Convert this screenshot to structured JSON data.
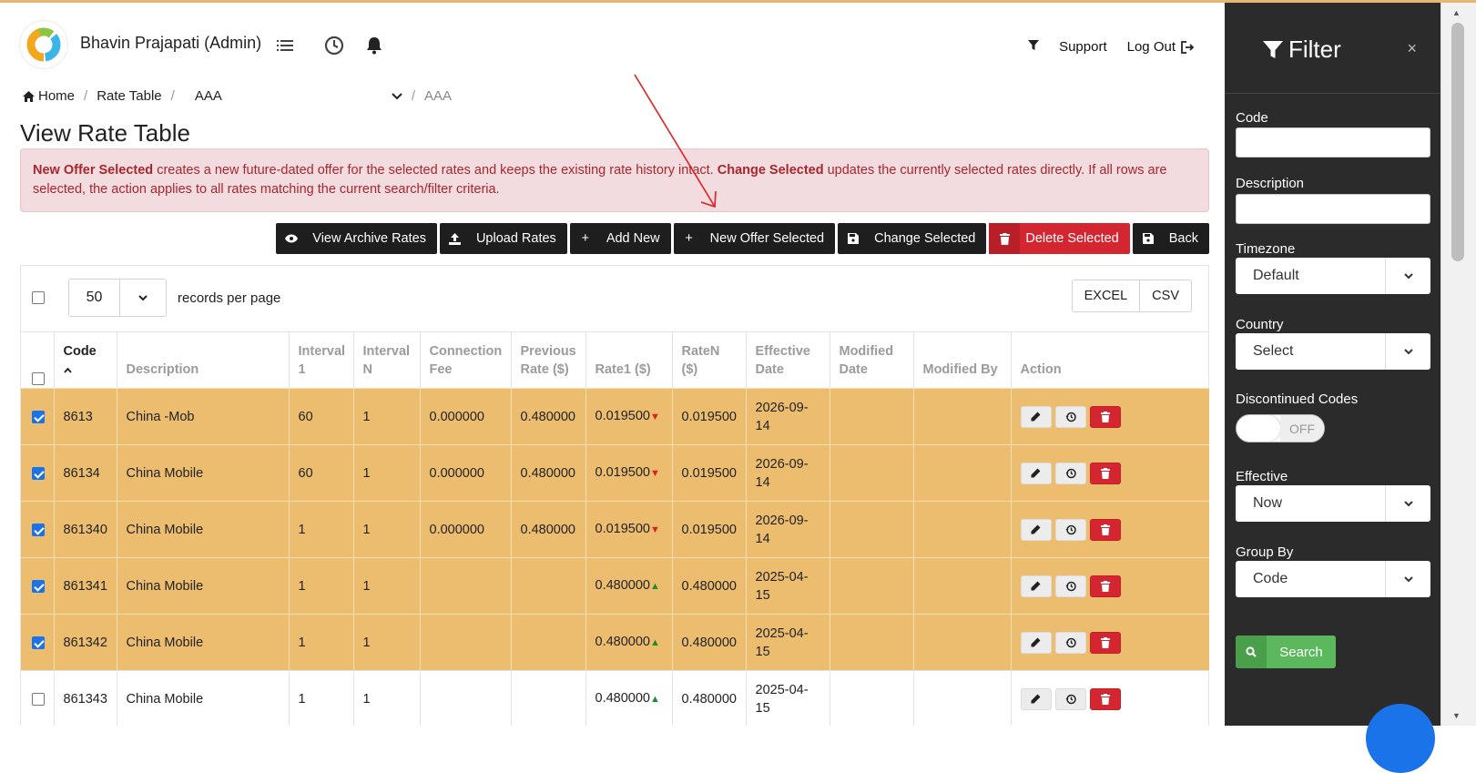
{
  "header": {
    "user": "Bhavin Prajapati (Admin)",
    "support": "Support",
    "logout": "Log Out"
  },
  "breadcrumb": {
    "home": "Home",
    "rate_table": "Rate Table",
    "selected": "AAA",
    "current": "AAA"
  },
  "page_title": "View Rate Table",
  "alert": {
    "strong1": "New Offer Selected",
    "text1": " creates a new future-dated offer for the selected rates and keeps the existing rate history intact. ",
    "strong2": "Change Selected",
    "text2": " updates the currently selected rates directly. If all rows are selected, the action applies to all rates matching the current search/filter criteria."
  },
  "buttons": {
    "archive": "View Archive Rates",
    "upload": "Upload Rates",
    "add": "Add New",
    "new_offer": "New Offer Selected",
    "change": "Change Selected",
    "delete": "Delete Selected",
    "back": "Back"
  },
  "table_controls": {
    "per_page": "50",
    "per_page_label": "records per page",
    "excel": "EXCEL",
    "csv": "CSV"
  },
  "columns": {
    "code": "Code",
    "description": "Description",
    "interval1": "Interval 1",
    "intervaln": "Interval N",
    "connection_fee": "Connection Fee",
    "previous_rate": "Previous Rate ($)",
    "rate1": "Rate1 ($)",
    "raten": "RateN ($)",
    "effective_date": "Effective Date",
    "modified_date": "Modified Date",
    "modified_by": "Modified By",
    "action": "Action"
  },
  "rows": [
    {
      "checked": true,
      "code": "8613",
      "description": "China -Mob",
      "interval1": "60",
      "intervaln": "1",
      "connection_fee": "0.000000",
      "previous_rate": "0.480000",
      "rate1": "0.019500",
      "trend": "down",
      "raten": "0.019500",
      "effective_date": "2026-09-14",
      "modified_date": "",
      "modified_by": ""
    },
    {
      "checked": true,
      "code": "86134",
      "description": "China Mobile",
      "interval1": "60",
      "intervaln": "1",
      "connection_fee": "0.000000",
      "previous_rate": "0.480000",
      "rate1": "0.019500",
      "trend": "down",
      "raten": "0.019500",
      "effective_date": "2026-09-14",
      "modified_date": "",
      "modified_by": ""
    },
    {
      "checked": true,
      "code": "861340",
      "description": "China Mobile",
      "interval1": "1",
      "intervaln": "1",
      "connection_fee": "0.000000",
      "previous_rate": "0.480000",
      "rate1": "0.019500",
      "trend": "down",
      "raten": "0.019500",
      "effective_date": "2026-09-14",
      "modified_date": "",
      "modified_by": ""
    },
    {
      "checked": true,
      "code": "861341",
      "description": "China Mobile",
      "interval1": "1",
      "intervaln": "1",
      "connection_fee": "",
      "previous_rate": "",
      "rate1": "0.480000",
      "trend": "up",
      "raten": "0.480000",
      "effective_date": "2025-04-15",
      "modified_date": "",
      "modified_by": ""
    },
    {
      "checked": true,
      "code": "861342",
      "description": "China Mobile",
      "interval1": "1",
      "intervaln": "1",
      "connection_fee": "",
      "previous_rate": "",
      "rate1": "0.480000",
      "trend": "up",
      "raten": "0.480000",
      "effective_date": "2025-04-15",
      "modified_date": "",
      "modified_by": ""
    },
    {
      "checked": false,
      "code": "861343",
      "description": "China Mobile",
      "interval1": "1",
      "intervaln": "1",
      "connection_fee": "",
      "previous_rate": "",
      "rate1": "0.480000",
      "trend": "up",
      "raten": "0.480000",
      "effective_date": "2025-04-15",
      "modified_date": "",
      "modified_by": ""
    }
  ],
  "filter": {
    "title": "Filter",
    "close": "×",
    "code_label": "Code",
    "code_value": "",
    "description_label": "Description",
    "description_value": "",
    "timezone_label": "Timezone",
    "timezone_value": "Default",
    "country_label": "Country",
    "country_value": "Select",
    "discontinued_label": "Discontinued Codes",
    "discontinued_value": "OFF",
    "effective_label": "Effective",
    "effective_value": "Now",
    "groupby_label": "Group By",
    "groupby_value": "Code",
    "search": "Search"
  },
  "colors": {
    "selected_row": "#ecbd6f",
    "danger": "#d32630",
    "success": "#5cb85c",
    "panel": "#2b2b2b",
    "annotation_arrow": "#e02020"
  }
}
